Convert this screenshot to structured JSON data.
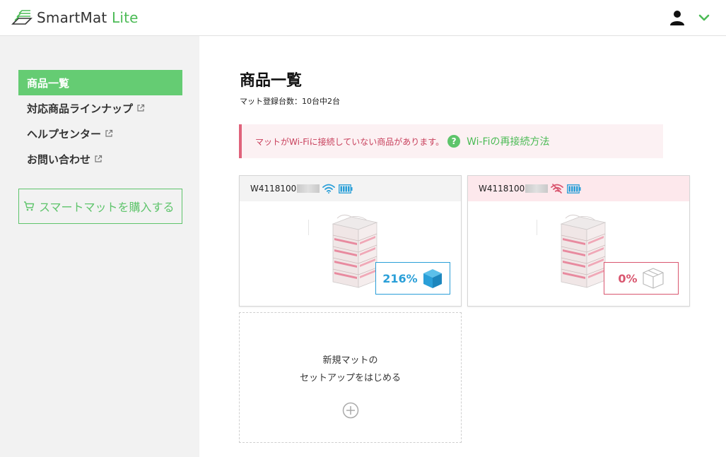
{
  "header": {
    "logo_main": "SmartMat",
    "logo_accent": "Lite"
  },
  "sidebar": {
    "items": [
      {
        "label": "商品一覧",
        "active": true
      },
      {
        "label": "対応商品ラインナップ",
        "external": true
      },
      {
        "label": "ヘルプセンター",
        "external": true
      },
      {
        "label": "お問い合わせ",
        "external": true
      }
    ],
    "buy_button": "スマートマットを購入する"
  },
  "main": {
    "title": "商品一覧",
    "subtitle": "マット登録台数：10台中2台",
    "alert": {
      "text": "マットがWi-Fiに接続していない商品があります。",
      "link": "Wi-Fiの再接続方法"
    },
    "cards": [
      {
        "id": "W4118100",
        "wifi": "connected",
        "stock": "216%",
        "status_color": "#2a9fd8"
      },
      {
        "id": "W4118100",
        "wifi": "disconnected",
        "stock": "0%",
        "status_color": "#d9566f"
      }
    ],
    "setup": {
      "line1": "新規マットの",
      "line2": "セットアップをはじめる"
    }
  },
  "colors": {
    "brand_green": "#5ec46b",
    "alert_red": "#d9566f",
    "stock_blue": "#2a9fd8"
  }
}
